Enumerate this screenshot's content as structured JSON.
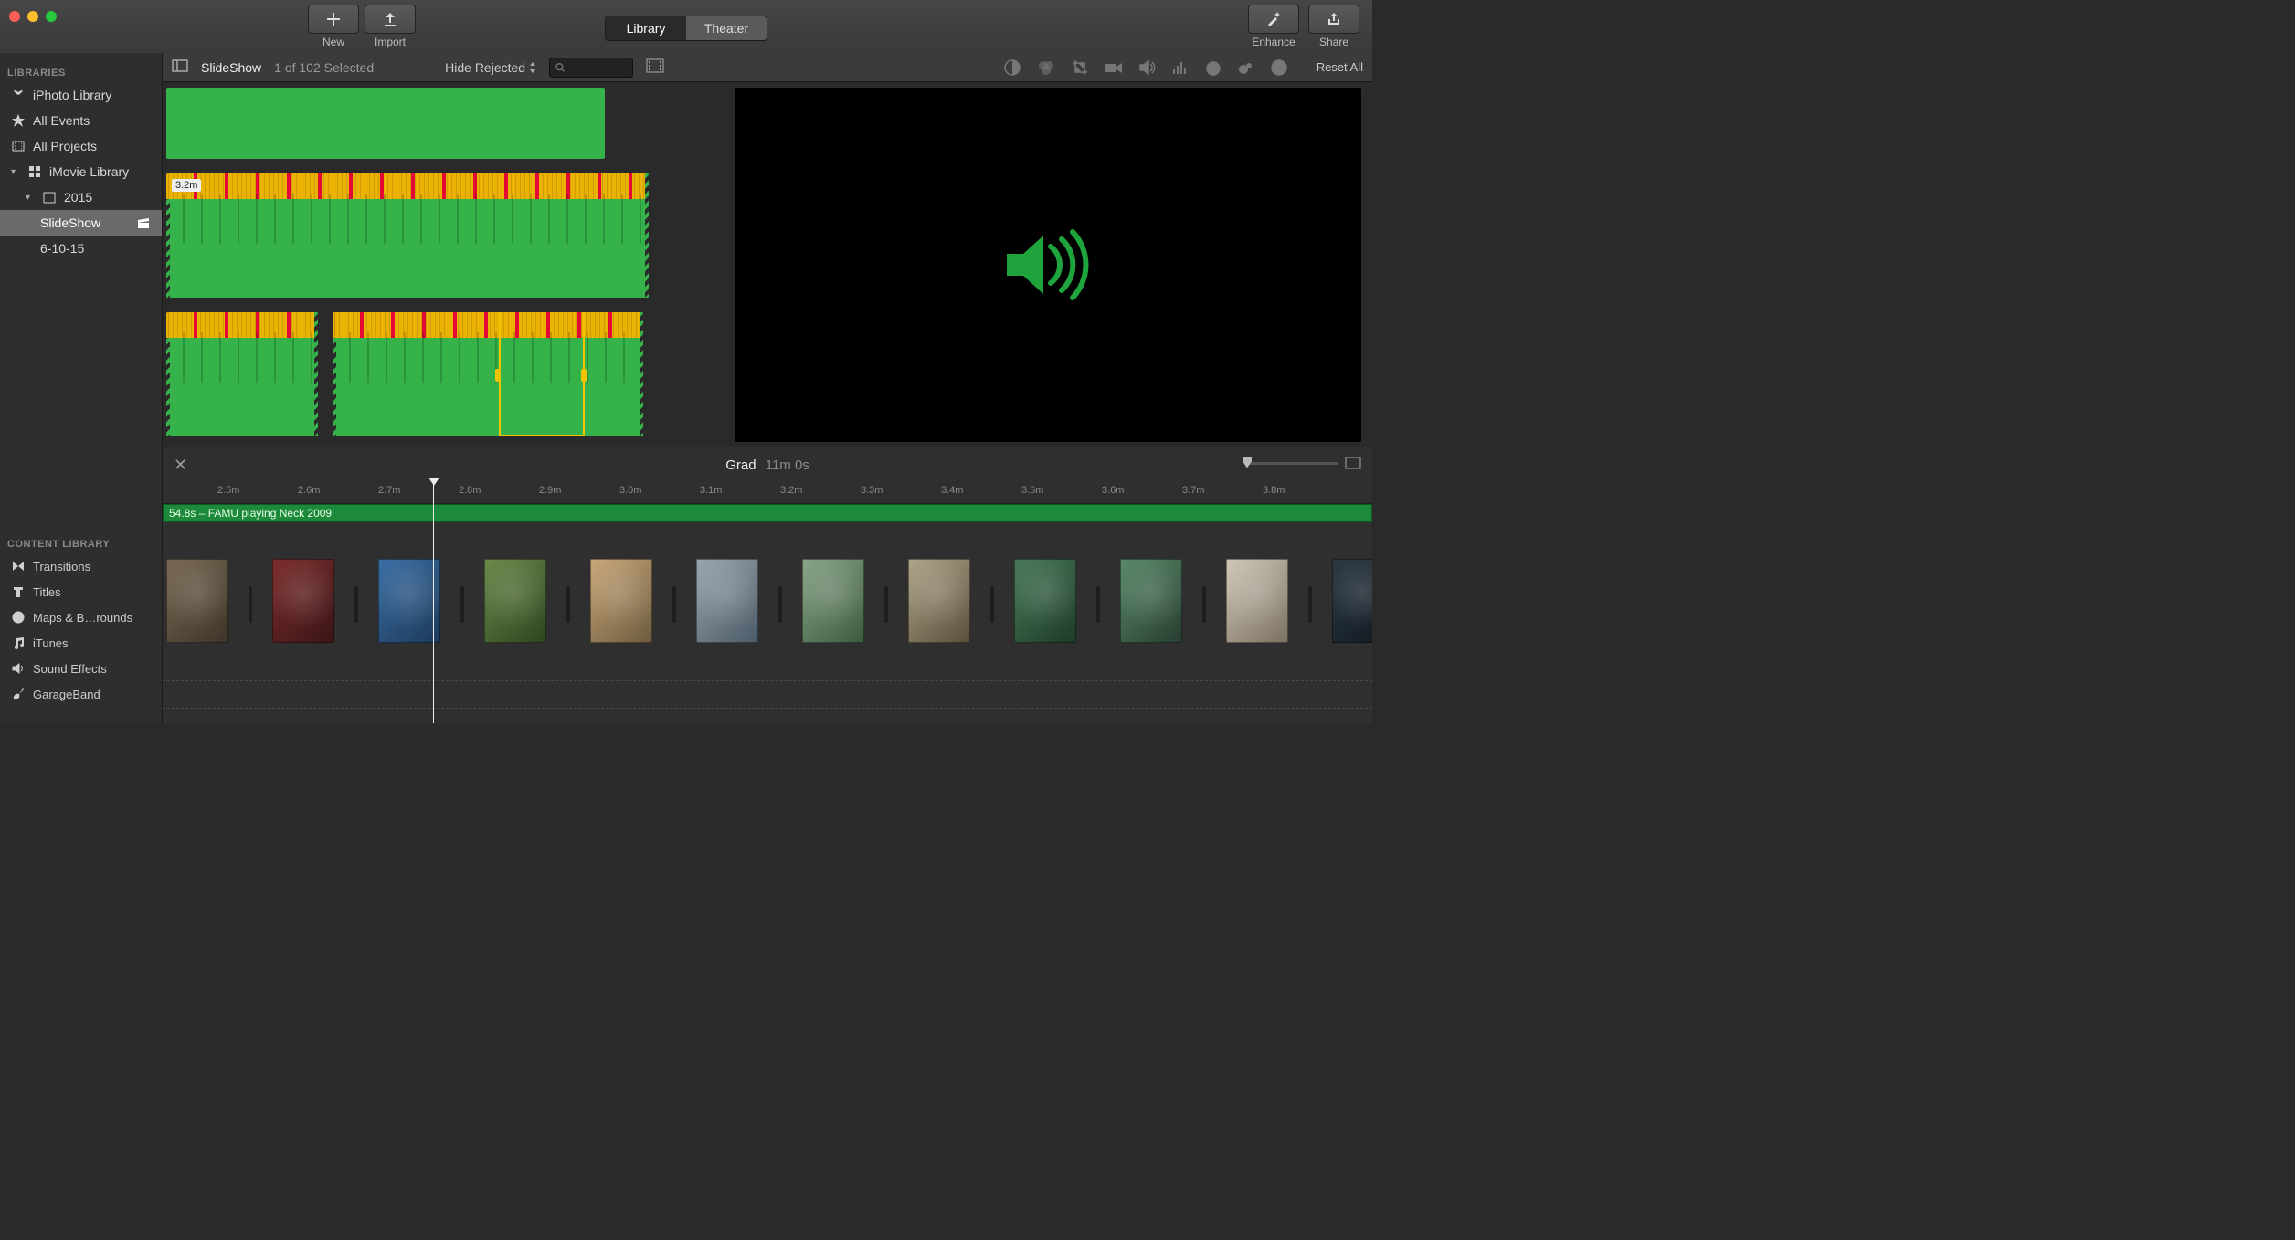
{
  "toolbar": {
    "new_label": "New",
    "import_label": "Import",
    "library_tab": "Library",
    "theater_tab": "Theater",
    "enhance_label": "Enhance",
    "share_label": "Share"
  },
  "sidebar": {
    "libraries_header": "LIBRARIES",
    "items": [
      {
        "label": "iPhoto Library"
      },
      {
        "label": "All Events"
      },
      {
        "label": "All Projects"
      },
      {
        "label": "iMovie Library"
      },
      {
        "label": "2015"
      },
      {
        "label": "SlideShow"
      },
      {
        "label": "6-10-15"
      }
    ],
    "content_header": "CONTENT LIBRARY",
    "content": [
      {
        "label": "Transitions"
      },
      {
        "label": "Titles"
      },
      {
        "label": "Maps & B…rounds"
      },
      {
        "label": "iTunes"
      },
      {
        "label": "Sound Effects"
      },
      {
        "label": "GarageBand"
      }
    ]
  },
  "browser": {
    "title": "SlideShow",
    "selection": "1 of 102 Selected",
    "filter": "Hide Rejected",
    "reset": "Reset All",
    "search_placeholder": "",
    "clip_badge": "3.2m"
  },
  "timeline": {
    "project_name": "Grad",
    "project_duration": "11m 0s",
    "ruler": [
      "2.5m",
      "2.6m",
      "2.7m",
      "2.8m",
      "2.9m",
      "3.0m",
      "3.1m",
      "3.2m",
      "3.3m",
      "3.4m",
      "3.5m",
      "3.6m",
      "3.7m",
      "3.8m"
    ],
    "audio_clip_label": "54.8s – FAMU playing Neck 2009"
  }
}
